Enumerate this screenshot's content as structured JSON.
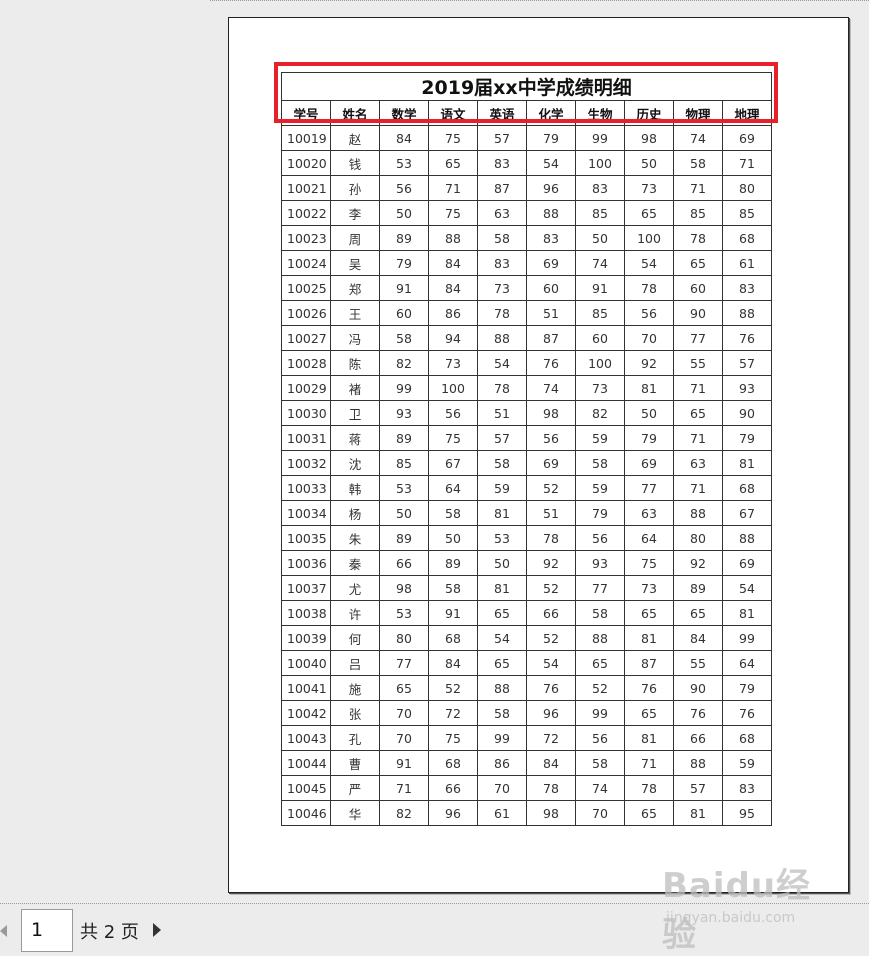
{
  "sheet": {
    "title": "2019届xx中学成绩明细",
    "headers": [
      "学号",
      "姓名",
      "数学",
      "语文",
      "英语",
      "化学",
      "生物",
      "历史",
      "物理",
      "地理"
    ],
    "rows": [
      [
        "10019",
        "赵",
        "84",
        "75",
        "57",
        "79",
        "99",
        "98",
        "74",
        "69"
      ],
      [
        "10020",
        "钱",
        "53",
        "65",
        "83",
        "54",
        "100",
        "50",
        "58",
        "71"
      ],
      [
        "10021",
        "孙",
        "56",
        "71",
        "87",
        "96",
        "83",
        "73",
        "71",
        "80"
      ],
      [
        "10022",
        "李",
        "50",
        "75",
        "63",
        "88",
        "85",
        "65",
        "85",
        "85"
      ],
      [
        "10023",
        "周",
        "89",
        "88",
        "58",
        "83",
        "50",
        "100",
        "78",
        "68"
      ],
      [
        "10024",
        "吴",
        "79",
        "84",
        "83",
        "69",
        "74",
        "54",
        "65",
        "61"
      ],
      [
        "10025",
        "郑",
        "91",
        "84",
        "73",
        "60",
        "91",
        "78",
        "60",
        "83"
      ],
      [
        "10026",
        "王",
        "60",
        "86",
        "78",
        "51",
        "85",
        "56",
        "90",
        "88"
      ],
      [
        "10027",
        "冯",
        "58",
        "94",
        "88",
        "87",
        "60",
        "70",
        "77",
        "76"
      ],
      [
        "10028",
        "陈",
        "82",
        "73",
        "54",
        "76",
        "100",
        "92",
        "55",
        "57"
      ],
      [
        "10029",
        "褚",
        "99",
        "100",
        "78",
        "74",
        "73",
        "81",
        "71",
        "93"
      ],
      [
        "10030",
        "卫",
        "93",
        "56",
        "51",
        "98",
        "82",
        "50",
        "65",
        "90"
      ],
      [
        "10031",
        "蒋",
        "89",
        "75",
        "57",
        "56",
        "59",
        "79",
        "71",
        "79"
      ],
      [
        "10032",
        "沈",
        "85",
        "67",
        "58",
        "69",
        "58",
        "69",
        "63",
        "81"
      ],
      [
        "10033",
        "韩",
        "53",
        "64",
        "59",
        "52",
        "59",
        "77",
        "71",
        "68"
      ],
      [
        "10034",
        "杨",
        "50",
        "58",
        "81",
        "51",
        "79",
        "63",
        "88",
        "67"
      ],
      [
        "10035",
        "朱",
        "89",
        "50",
        "53",
        "78",
        "56",
        "64",
        "80",
        "88"
      ],
      [
        "10036",
        "秦",
        "66",
        "89",
        "50",
        "92",
        "93",
        "75",
        "92",
        "69"
      ],
      [
        "10037",
        "尤",
        "98",
        "58",
        "81",
        "52",
        "77",
        "73",
        "89",
        "54"
      ],
      [
        "10038",
        "许",
        "53",
        "91",
        "65",
        "66",
        "58",
        "65",
        "65",
        "81"
      ],
      [
        "10039",
        "何",
        "80",
        "68",
        "54",
        "52",
        "88",
        "81",
        "84",
        "99"
      ],
      [
        "10040",
        "吕",
        "77",
        "84",
        "65",
        "54",
        "65",
        "87",
        "55",
        "64"
      ],
      [
        "10041",
        "施",
        "65",
        "52",
        "88",
        "76",
        "52",
        "76",
        "90",
        "79"
      ],
      [
        "10042",
        "张",
        "70",
        "72",
        "58",
        "96",
        "99",
        "65",
        "76",
        "76"
      ],
      [
        "10043",
        "孔",
        "70",
        "75",
        "99",
        "72",
        "56",
        "81",
        "66",
        "68"
      ],
      [
        "10044",
        "曹",
        "91",
        "68",
        "86",
        "84",
        "58",
        "71",
        "88",
        "59"
      ],
      [
        "10045",
        "严",
        "71",
        "66",
        "70",
        "78",
        "74",
        "78",
        "57",
        "83"
      ],
      [
        "10046",
        "华",
        "82",
        "96",
        "61",
        "98",
        "70",
        "65",
        "81",
        "95"
      ]
    ]
  },
  "pager": {
    "current_page": "1",
    "total_label": "共 2 页"
  },
  "watermark": {
    "main": "Baidu经验",
    "sub": "jingyan.baidu.com"
  },
  "colors": {
    "highlight": "#e8202a",
    "background": "#ececec"
  }
}
